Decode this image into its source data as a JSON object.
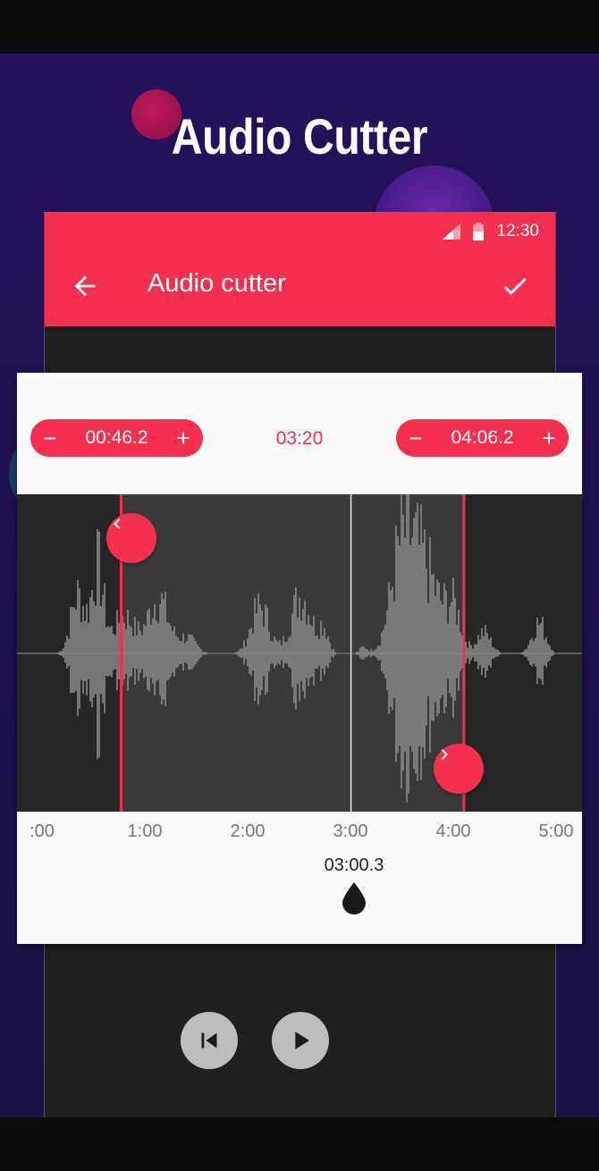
{
  "promo": {
    "title": "Audio Cutter"
  },
  "status_bar": {
    "time": "12:30"
  },
  "app_bar": {
    "title": "Audio cutter",
    "back_icon": "arrow-back-icon",
    "confirm_icon": "check-icon"
  },
  "trim": {
    "start": {
      "minus": "−",
      "value": "00:46.2",
      "plus": "+"
    },
    "duration": "03:20",
    "end": {
      "minus": "−",
      "value": "04:06.2",
      "plus": "+"
    }
  },
  "timeline": {
    "ticks": [
      ":00",
      "1:00",
      "2:00",
      "3:00",
      "4:00",
      "5:00"
    ],
    "playhead": "03:00.3",
    "selection_start_seconds": 46.2,
    "selection_end_seconds": 246.2,
    "playhead_seconds": 180.3
  },
  "colors": {
    "accent": "#f42f4f",
    "promo_bg": "#24125c",
    "wave": "#8a8a8a",
    "wave_bg": "#262626",
    "selected_bg": "#3a3a3a"
  },
  "player": {
    "prev_icon": "skip-previous-icon",
    "play_icon": "play-icon"
  }
}
